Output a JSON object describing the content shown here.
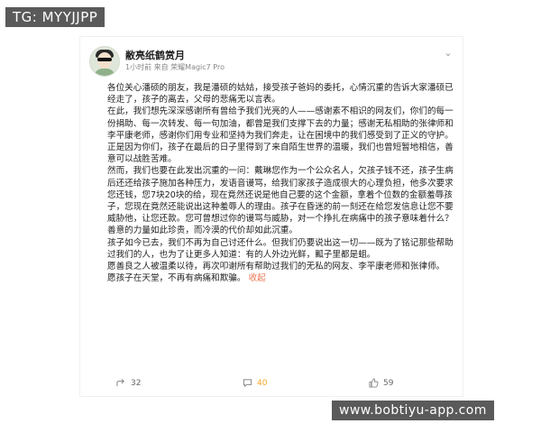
{
  "watermark_top": "TG: MYYJJPP",
  "watermark_bottom": "www.bobtiyu-app.com",
  "post": {
    "username": "敝亮纸鹤赏月",
    "meta": "1小时前 来自 荣耀Magic7 Pro",
    "paragraphs": [
      "各位关心潘硕的朋友，我是潘硕的姑姑，接受孩子爸妈的委托，心情沉重的告诉大家潘硕已经走了，孩子的离去，父母的悲痛无以言表。",
      "在此，我们想先深深感谢所有曾给予我们光亮的人——感谢素不相识的网友们，你们的每一份捐助、每一次转发、每一句加油，都曾是我们支撑下去的力量；感谢无私相助的张律师和李平康老师，感谢你们用专业和坚持为我们奔走，让在困境中的我们感受到了正义的守护。",
      "正是因为你们，孩子在最后的日子里得到了来自陌生世界的温暖，我们也曾短暂地相信，善意可以战胜苦难。",
      "然而，我们也要在此发出沉重的一问：戴琳您作为一个公众名人，欠孩子钱不还，孩子生病后还还给孩子施加各种压力，发语音谩骂，给我们家孩子造成很大的心理负担，他多次要求您还钱，您7块20块的给，现在竟然还说是他自己要的这个金额，拿着个位数的金额羞辱孩子，您现在竟然还能说出这种羞辱人的理由。孩子在昏迷的前一刻还在给您发信息让您不要威胁他，让您还款。您可曾想过你的谩骂与威胁，对一个挣扎在病痛中的孩子意味着什么？",
      "善意的力量如此珍贵，而冷漠的代价却如此沉重。",
      "孩子如今已去，我们不再为自己讨还什么。但我们仍要说出这一切——既为了铭记那些帮助过我们的人，也为了让更多人知道：有的人外边光鲜，瓤子里都是蛆。",
      "愿善良之人被温柔以待，再次叩谢所有帮助过我们的无私的网友、李平康老师和张律师。"
    ],
    "last_line": "愿孩子在天堂，不再有病痛和欺骗。",
    "collapse_label": "收起"
  },
  "actions": {
    "share_count": "32",
    "comment_count": "40",
    "like_count": "59"
  },
  "colors": {
    "link": "#eb7350",
    "like": "#f5a623"
  }
}
